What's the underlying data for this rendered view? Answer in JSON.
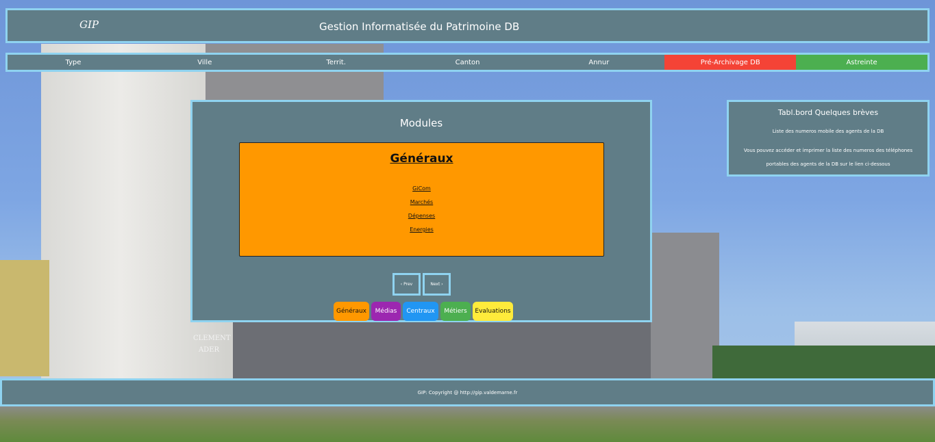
{
  "header": {
    "logo": "GIP",
    "title": "Gestion Informatisée du Patrimoine DB"
  },
  "nav": {
    "items": [
      {
        "label": "Type"
      },
      {
        "label": "Ville"
      },
      {
        "label": "Territ."
      },
      {
        "label": "Canton"
      },
      {
        "label": "Annur"
      },
      {
        "label": "Pré-Archivage DB"
      },
      {
        "label": "Astreinte"
      }
    ]
  },
  "modules": {
    "title": "Modules",
    "card": {
      "title": "Généraux",
      "links": [
        "GiCom",
        "Marchés",
        "Dépenses",
        "Energies"
      ]
    },
    "pager": {
      "prev": "‹ Prev",
      "next": "Next ›"
    },
    "tabs": [
      "Généraux",
      "Médias",
      "Centraux",
      "Métiers",
      "Evaluations"
    ]
  },
  "news": {
    "title": "Tabl.bord Quelques brèves",
    "line1": "Liste des numeros mobile des agents de la DB",
    "line2": "Vous pouvez accéder et imprimer la liste des numeros des téléphones portables des agents de la DB sur le lien ci-dessous"
  },
  "background": {
    "sign": "CLEMENT ADER"
  },
  "footer": {
    "text": "GIP: Copyright @ http://gip.valdemarne.fr"
  },
  "colors": {
    "panel": "#607d87",
    "panel_border": "#8fd3f0",
    "accent_orange": "#ff9800",
    "accent_red": "#f44336",
    "accent_green": "#4caf50",
    "accent_purple": "#9c27b0",
    "accent_blue": "#2196f3",
    "accent_yellow": "#ffeb3b"
  }
}
